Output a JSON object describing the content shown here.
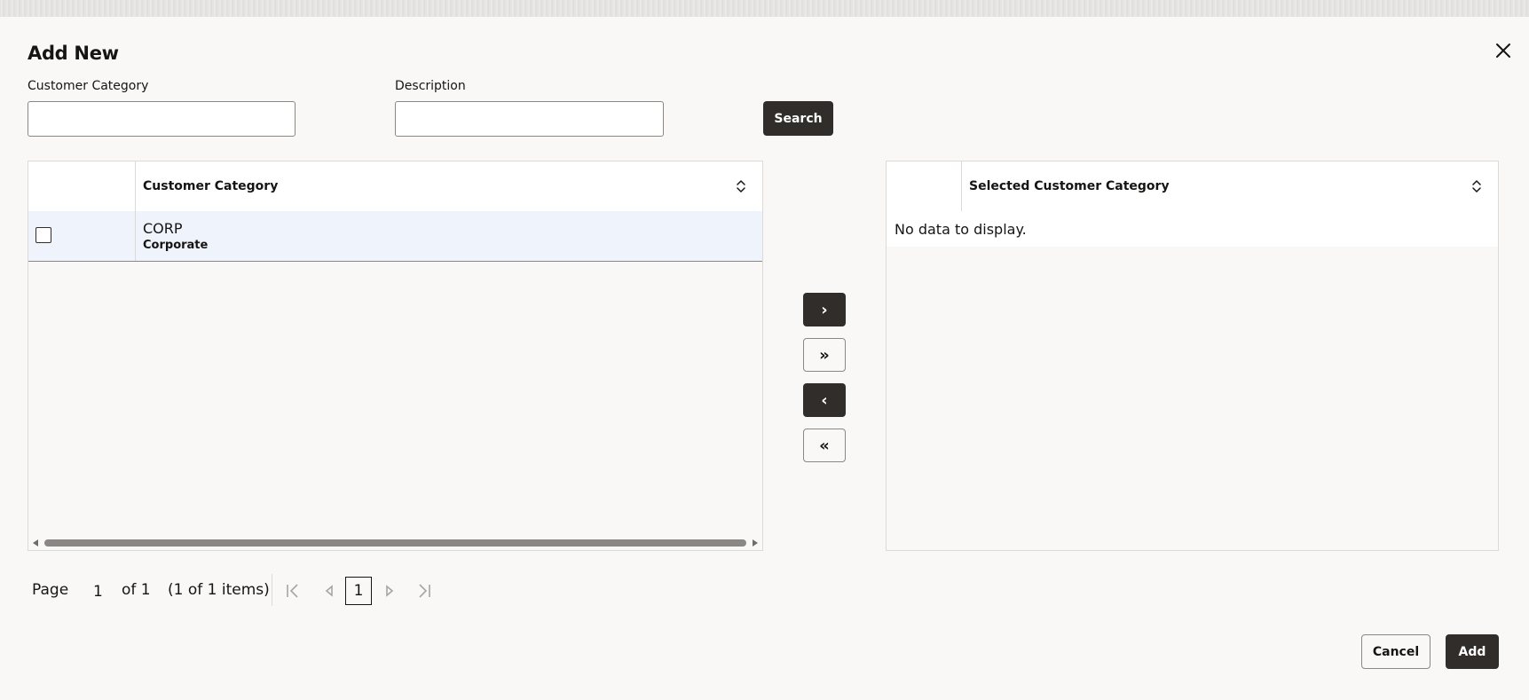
{
  "dialog": {
    "title": "Add New",
    "close_icon": "close-icon"
  },
  "filters": {
    "customer_category_label": "Customer Category",
    "customer_category_value": "",
    "description_label": "Description",
    "description_value": "",
    "search_label": "Search"
  },
  "available": {
    "column_header": "Customer Category",
    "rows": [
      {
        "code": "CORP",
        "description": "Corporate",
        "checked": false
      }
    ]
  },
  "selected": {
    "column_header": "Selected Customer Category",
    "empty_text": "No data to display."
  },
  "shuttle": {
    "move_selected": "›",
    "move_all": "»",
    "remove_selected": "‹",
    "remove_all": "«"
  },
  "pagination": {
    "page_label": "Page",
    "page_value": "1",
    "of_label": "of 1",
    "items_label": "(1 of 1 items)",
    "current_page": "1"
  },
  "footer": {
    "cancel_label": "Cancel",
    "add_label": "Add"
  },
  "colors": {
    "primary_button": "#312d2a",
    "row_highlight": "#eff3fb",
    "background": "#f9f8f7"
  }
}
